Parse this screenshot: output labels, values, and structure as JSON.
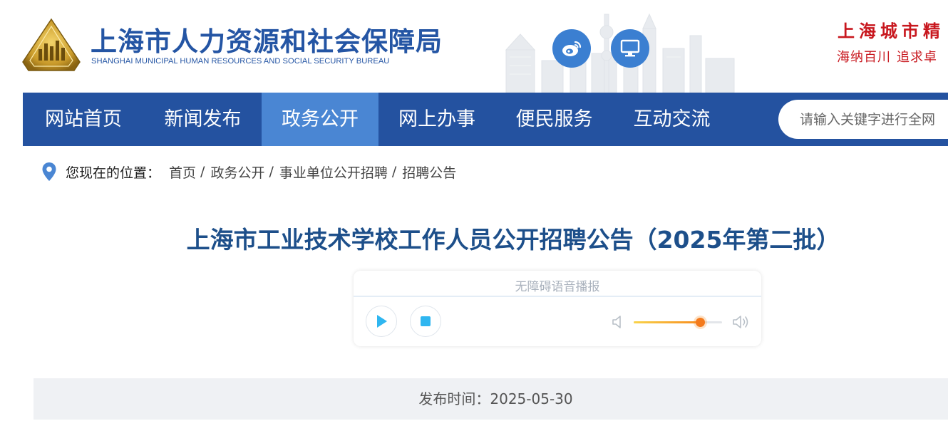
{
  "header": {
    "title": "上海市人力资源和社会保障局",
    "subtitle": "SHANGHAI MUNICIPAL HUMAN RESOURCES AND SOCIAL SECURITY BUREAU",
    "slogan": "上海城市精",
    "slogan_sub_1": "海纳百川",
    "slogan_sub_2": "追求卓",
    "brand_color": "#2455a4",
    "icons": [
      "weibo-icon",
      "monitor-icon"
    ]
  },
  "nav": {
    "items": [
      {
        "label": "网站首页"
      },
      {
        "label": "新闻发布"
      },
      {
        "label": "政务公开"
      },
      {
        "label": "网上办事"
      },
      {
        "label": "便民服务"
      },
      {
        "label": "互动交流"
      }
    ],
    "active": "政务公开",
    "search_placeholder": "请输入关键字进行全网",
    "bg_color": "#2452a0",
    "active_color": "#4a86d3"
  },
  "breadcrumb": {
    "prefix": "您现在的位置：",
    "items": [
      "首页",
      "政务公开",
      "事业单位公开招聘",
      "招聘公告"
    ],
    "separator": "/"
  },
  "article": {
    "title": "上海市工业技术学校工作人员公开招聘公告（2025年第二批）",
    "title_color": "#1d4f8a"
  },
  "player": {
    "label": "无障碍语音播报",
    "volume": 0.75,
    "icons": [
      "play-icon",
      "stop-icon",
      "volume-low-icon",
      "volume-high-icon"
    ]
  },
  "publish": {
    "label": "发布时间：",
    "date": "2025-05-30"
  }
}
